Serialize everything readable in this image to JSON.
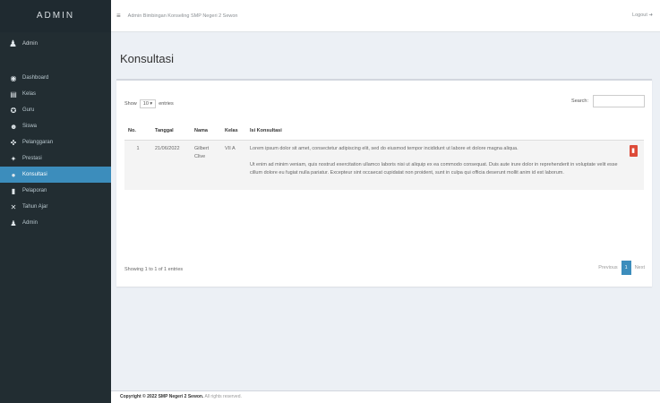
{
  "brand": "ADMIN",
  "user": {
    "name": "Admin"
  },
  "sidebar": {
    "items": [
      {
        "label": "Dashboard",
        "icon": "dashboard-icon",
        "glyph": "◉"
      },
      {
        "label": "Kelas",
        "icon": "list-icon",
        "glyph": "▤"
      },
      {
        "label": "Guru",
        "icon": "graduation-icon",
        "glyph": "✪"
      },
      {
        "label": "Siswa",
        "icon": "user-icon",
        "glyph": "☻"
      },
      {
        "label": "Pelanggaran",
        "icon": "warning-icon",
        "glyph": "✜"
      },
      {
        "label": "Prestasi",
        "icon": "trophy-icon",
        "glyph": "✦"
      },
      {
        "label": "Konsultasi",
        "icon": "chat-icon",
        "glyph": "●"
      },
      {
        "label": "Pelaporan",
        "icon": "file-icon",
        "glyph": "▮"
      },
      {
        "label": "Tahun Ajar",
        "icon": "crossroads-icon",
        "glyph": "✕"
      },
      {
        "label": "Admin",
        "icon": "person-icon",
        "glyph": "♟"
      }
    ],
    "active_index": 6
  },
  "header": {
    "title": "Admin Bimbingan Konseling SMP Negeri 2 Sewon",
    "logout": "Logout"
  },
  "page": {
    "title": "Konsultasi"
  },
  "table_controls": {
    "show_prefix": "Show",
    "show_value": "10",
    "show_suffix": "entries",
    "search_label": "Search:"
  },
  "table": {
    "columns": [
      "No.",
      "Tanggal",
      "Nama",
      "Kelas",
      "Isi Konsultasi"
    ],
    "rows": [
      {
        "no": "1",
        "tanggal": "21/06/2022",
        "nama": "Gilbert Clive",
        "kelas": "VII A",
        "isi": [
          "Lorem ipsum dolor sit amet, consectetur adipiscing elit, sed do eiusmod tempor incididunt ut labore et dolore magna aliqua.",
          "Ut enim ad minim veniam, quis nostrud exercitation ullamco laboris nisi ut aliquip ex ea commodo consequat. Duis aute irure dolor in reprehenderit in voluptate velit esse cillum dolore eu fugiat nulla pariatur. Excepteur sint occaecat cupidatat non proident, sunt in culpa qui officia deserunt mollit anim id est laborum."
        ]
      }
    ]
  },
  "footer_info": "Showing 1 to 1 of 1 entries",
  "pagination": {
    "previous": "Previous",
    "current": "1",
    "next": "Next"
  },
  "footer": {
    "copyright": "Copyright © 2022 SMP Negeri 2 Sewon.",
    "rights": "All rights reserved."
  },
  "colors": {
    "sidebar": "#222d32",
    "active": "#3c8dbc",
    "danger": "#dd4b39"
  }
}
